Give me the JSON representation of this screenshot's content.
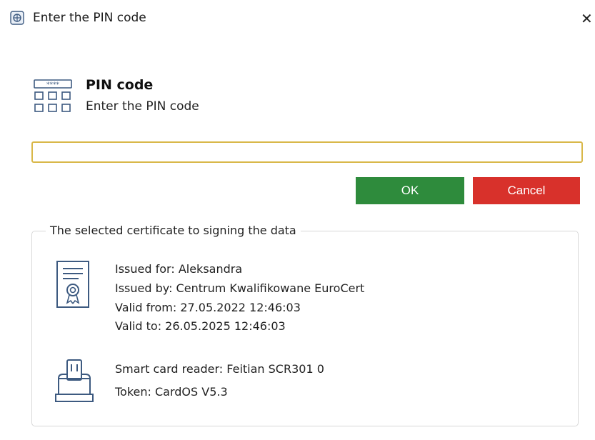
{
  "window": {
    "title": "Enter the PIN code",
    "close_label": "✕"
  },
  "header": {
    "heading": "PIN code",
    "subheading": "Enter the PIN code"
  },
  "pin_input": {
    "value": "",
    "placeholder": ""
  },
  "buttons": {
    "ok_label": "OK",
    "cancel_label": "Cancel"
  },
  "certificate": {
    "legend": "The selected certificate to signing the data",
    "issued_for": "Issued for: Aleksandra",
    "issued_by": "Issued by: Centrum Kwalifikowane EuroCert",
    "valid_from": "Valid from: 27.05.2022 12:46:03",
    "valid_to": "Valid to: 26.05.2025 12:46:03"
  },
  "reader": {
    "smart_card_reader": "Smart card reader: Feitian SCR301 0",
    "token": "Token: CardOS V5.3"
  },
  "colors": {
    "ok_button": "#2e8b3c",
    "cancel_button": "#d8312b",
    "input_border": "#d9b84a",
    "icon_stroke": "#3d5a80"
  },
  "icons": {
    "title": "app-shield-icon",
    "pin": "pin-keypad-icon",
    "certificate": "certificate-document-icon",
    "reader": "smart-card-reader-icon"
  }
}
